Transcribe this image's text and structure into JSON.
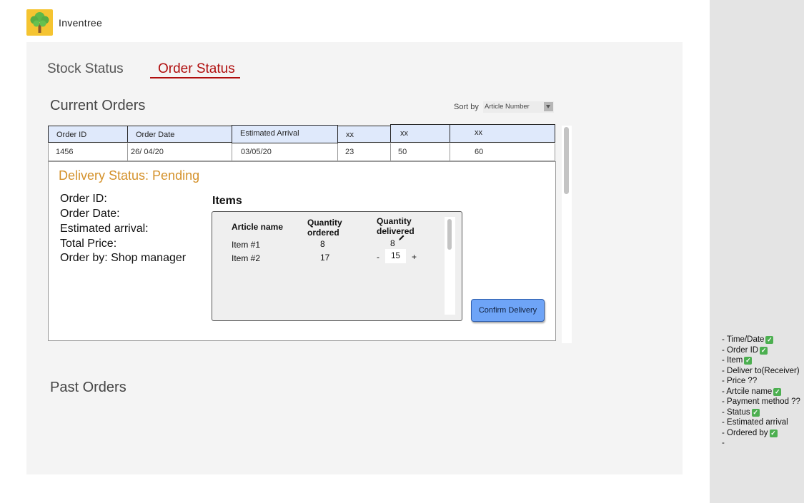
{
  "app": {
    "title": "Inventree",
    "logo_colors": {
      "background": "#f5c431",
      "foliage": "#5fb84a",
      "trunk": "#8b5a2b"
    }
  },
  "tabs": [
    {
      "label": "Stock Status",
      "active": false
    },
    {
      "label": "Order Status",
      "active": true
    }
  ],
  "accent_color": "#b00e0e",
  "current_orders": {
    "title": "Current Orders",
    "sort": {
      "label": "Sort by",
      "selected": "Article Number"
    },
    "table": {
      "headers": [
        "Order ID",
        "Order Date",
        "Estimated Arrival",
        "xx",
        "xx",
        "xx"
      ],
      "row": [
        "1456",
        "26/ 04/20",
        "03/05/20",
        "23",
        "50",
        "60"
      ]
    }
  },
  "detail": {
    "delivery_status": "Delivery Status:  Pending",
    "status_color": "#d4912a",
    "info": [
      "Order ID:",
      "Order Date:",
      "Estimated arrival:",
      "Total Price:",
      "Order by: Shop manager"
    ],
    "items_title": "Items",
    "items_table": {
      "headers": {
        "article": "Article name",
        "ordered": "Quantity ordered",
        "delivered": "Quantity delivered"
      },
      "rows": [
        {
          "name": "Item #1",
          "ordered": "8",
          "delivered": "8"
        },
        {
          "name": "Item #2",
          "ordered": "17",
          "delivered": "15"
        }
      ],
      "stepper": {
        "minus": "-",
        "plus": "+"
      }
    },
    "confirm_label": "Confirm Delivery",
    "confirm_color": "#6ea4f7"
  },
  "past_orders": {
    "title": "Past Orders"
  },
  "notes": [
    {
      "text": "- Time/Date",
      "checked": true
    },
    {
      "text": "- Order ID",
      "checked": true
    },
    {
      "text": "- Item",
      "checked": true
    },
    {
      "text": "- Deliver to(Receiver)",
      "checked": false
    },
    {
      "text": "- Price ??",
      "checked": false
    },
    {
      "text": "- Artcile name",
      "checked": true
    },
    {
      "text": "- Payment method ??",
      "checked": false
    },
    {
      "text": "- Status",
      "checked": true
    },
    {
      "text": "- Estimated arrival",
      "checked": false
    },
    {
      "text": "- Ordered by",
      "checked": true
    },
    {
      "text": "-",
      "checked": false
    }
  ]
}
